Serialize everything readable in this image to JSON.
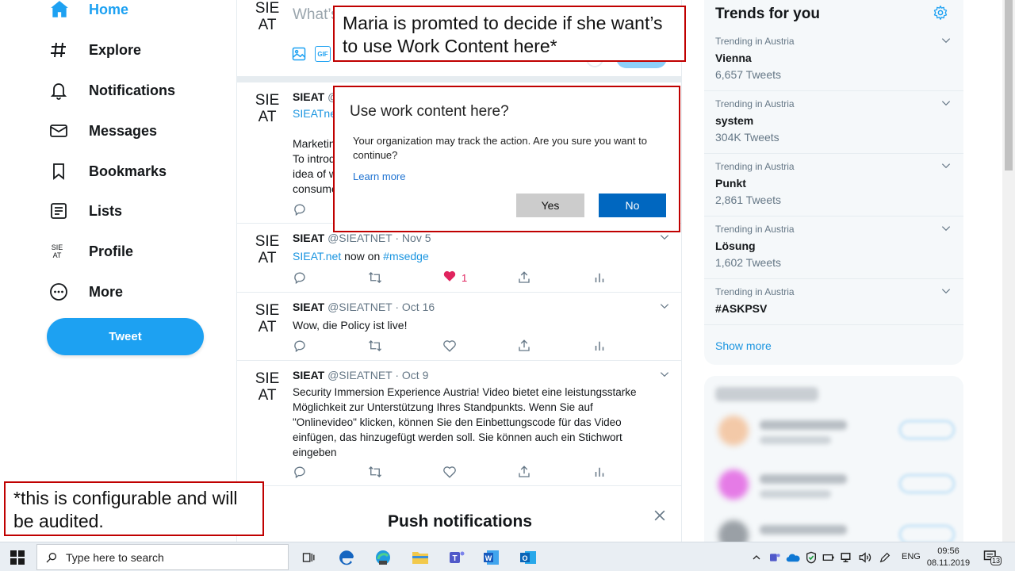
{
  "nav": {
    "items": [
      {
        "label": "Home",
        "icon": "home-icon"
      },
      {
        "label": "Explore",
        "icon": "hashtag-icon"
      },
      {
        "label": "Notifications",
        "icon": "bell-icon"
      },
      {
        "label": "Messages",
        "icon": "envelope-icon"
      },
      {
        "label": "Bookmarks",
        "icon": "bookmark-icon"
      },
      {
        "label": "Lists",
        "icon": "list-icon"
      },
      {
        "label": "Profile",
        "icon": "avatar-icon"
      },
      {
        "label": "More",
        "icon": "more-icon"
      }
    ],
    "profile_avatar_top": "SIE",
    "profile_avatar_bottom": "AT",
    "tweet_button": "Tweet"
  },
  "compose": {
    "avatar_top": "SIE",
    "avatar_bottom": "AT",
    "placeholder": "What’s"
  },
  "tweets": [
    {
      "avatar_top": "SIE",
      "avatar_bottom": "AT",
      "name": "SIEAT",
      "handle": "@",
      "link": "SIEATne",
      "lines": [
        "Marketin",
        "To introd",
        "idea of w",
        "consume"
      ]
    },
    {
      "avatar_top": "SIE",
      "avatar_bottom": "AT",
      "name": "SIEAT",
      "handle": "@SIEATNET",
      "date": "Nov 5",
      "text_link1": "SIEAT.net",
      "text_mid": " now on ",
      "text_link2": "#msedge",
      "likes": "1"
    },
    {
      "avatar_top": "SIE",
      "avatar_bottom": "AT",
      "name": "SIEAT",
      "handle": "@SIEATNET",
      "date": "Oct 16",
      "text": "Wow, die Policy ist live!"
    },
    {
      "avatar_top": "SIE",
      "avatar_bottom": "AT",
      "name": "SIEAT",
      "handle": "@SIEATNET",
      "date": "Oct 9",
      "lines": [
        "Security Immersion Experience Austria! Video bietet eine leistungsstarke",
        "Möglichkeit zur Unterstützung Ihres Standpunkts. Wenn Sie auf",
        "\"Onlinevideo\" klicken, können Sie den Einbettungscode für das Video",
        "einfügen, das hinzugefügt werden soll. Sie können auch ein Stichwort",
        "eingeben"
      ]
    }
  ],
  "push": {
    "title": "Push notifications"
  },
  "dialog": {
    "title": "Use work content here?",
    "text": "Your organization may track the action. Are you sure you want to continue?",
    "learn_more": "Learn more",
    "yes": "Yes",
    "no": "No"
  },
  "annotations": {
    "top": "Maria is promted to decide if she want’s to use Work Content here*",
    "bottom": "*this is configurable and will be audited."
  },
  "trends": {
    "title": "Trends for you",
    "items": [
      {
        "context": "Trending in Austria",
        "name": "Vienna",
        "count": "6,657 Tweets"
      },
      {
        "context": "Trending in Austria",
        "name": "system",
        "count": "304K Tweets"
      },
      {
        "context": "Trending in Austria",
        "name": "Punkt",
        "count": "2,861 Tweets"
      },
      {
        "context": "Trending in Austria",
        "name": "Lösung",
        "count": "1,602 Tweets"
      },
      {
        "context": "Trending in Austria",
        "name": "#ASKPSV",
        "count": ""
      }
    ],
    "show_more": "Show more"
  },
  "taskbar": {
    "search_placeholder": "Type here to search",
    "language": "ENG",
    "time": "09:56",
    "date": "08.11.2019",
    "notification_count": "13"
  },
  "colors": {
    "accent": "#1da1f2",
    "annotation_border": "#c00000",
    "dialog_primary": "#0067c0",
    "like": "#e0245e"
  }
}
